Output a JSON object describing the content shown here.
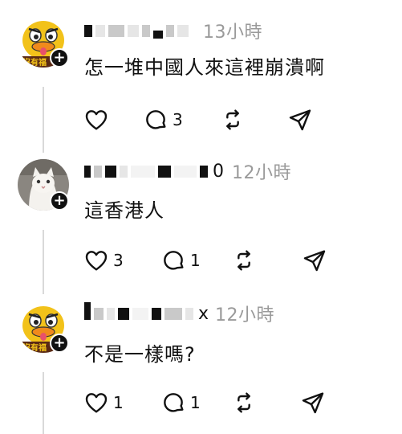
{
  "comments": [
    {
      "username_visible_suffix": "",
      "timestamp": "13小時",
      "text": "怎一堆中國人來這裡崩潰啊",
      "avatar_caption": "沒有福",
      "likes": "",
      "replies": "3",
      "reposts": "",
      "shares": ""
    },
    {
      "username_visible_suffix": "0",
      "timestamp": "12小時",
      "text": "這香港人",
      "avatar_caption": "",
      "likes": "3",
      "replies": "1",
      "reposts": "",
      "shares": ""
    },
    {
      "username_visible_suffix": "x",
      "timestamp": "12小時",
      "text": "不是一樣嗎?",
      "avatar_caption": "沒有福",
      "likes": "1",
      "replies": "1",
      "reposts": "",
      "shares": ""
    }
  ],
  "icons": {
    "like": "heart-icon",
    "reply": "speech-bubble-icon",
    "repost": "repost-icon",
    "share": "send-icon",
    "follow": "plus-icon"
  },
  "colors": {
    "text": "#111111",
    "timestamp": "#9a9a9a",
    "thread_line": "#d9d9d9",
    "avatar_yellow": "#f2c21a"
  }
}
